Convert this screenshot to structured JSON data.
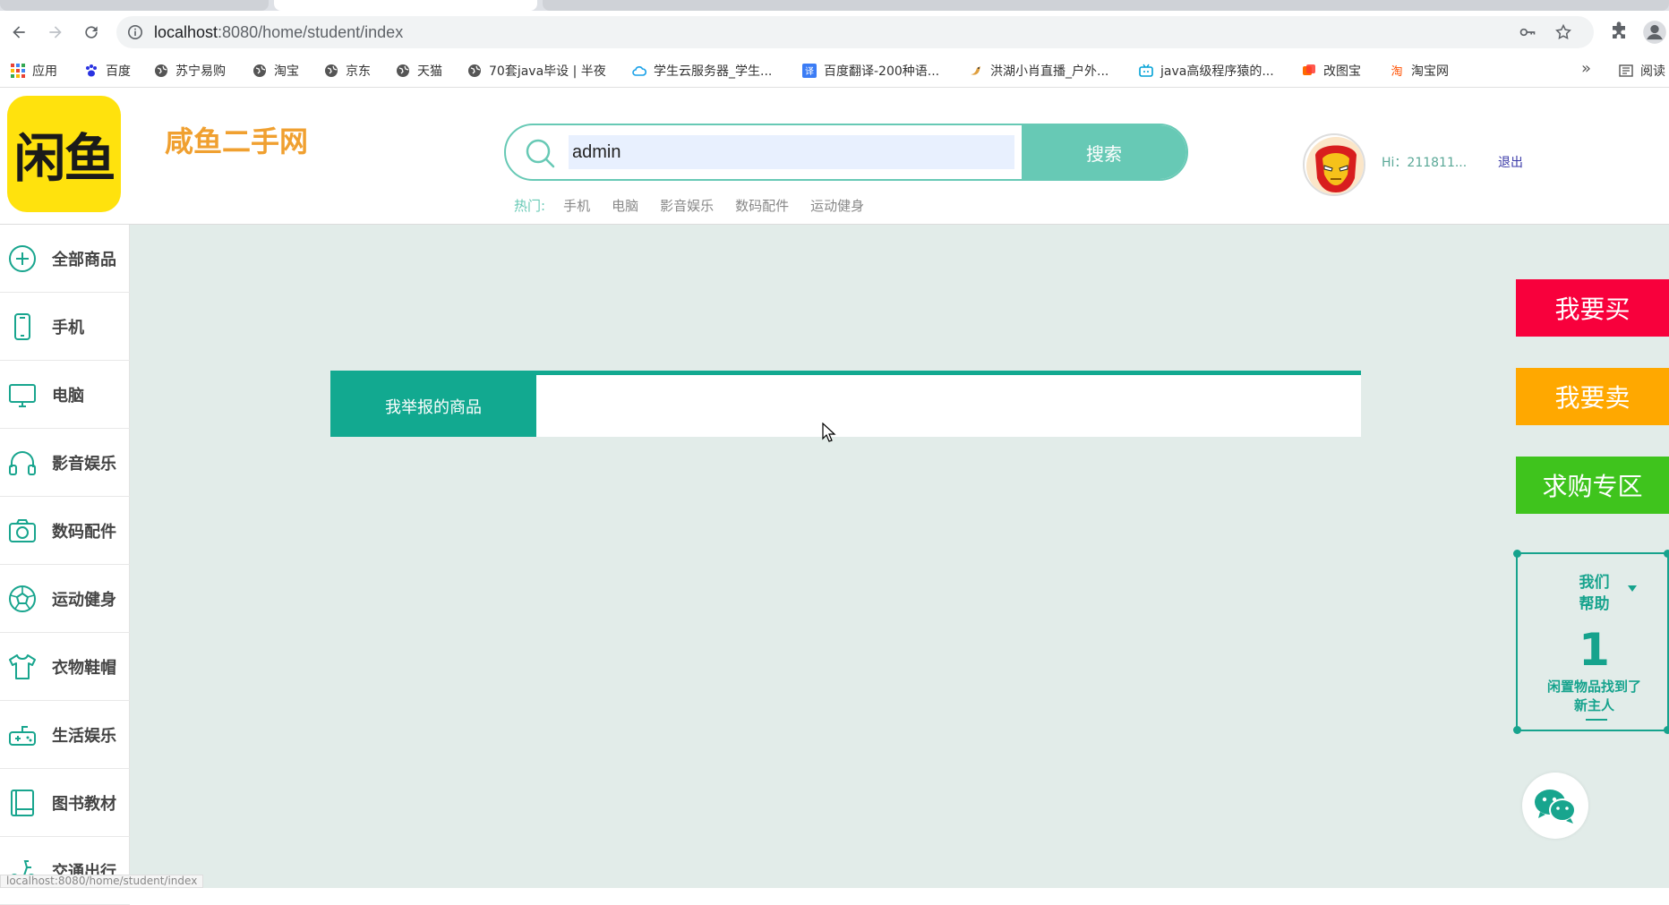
{
  "browser": {
    "url_host": "localhost",
    "url_path": ":8080/home/student/index",
    "bookmarks": [
      {
        "label": "应用",
        "icon": "apps-grid-icon"
      },
      {
        "label": "百度",
        "icon": "baidu-paw-icon"
      },
      {
        "label": "苏宁易购",
        "icon": "globe-icon"
      },
      {
        "label": "淘宝",
        "icon": "globe-icon"
      },
      {
        "label": "京东",
        "icon": "globe-icon"
      },
      {
        "label": "天猫",
        "icon": "globe-icon"
      },
      {
        "label": "70套java毕设 | 半夜",
        "icon": "globe-icon"
      },
      {
        "label": "学生云服务器_学生...",
        "icon": "cloud-icon"
      },
      {
        "label": "百度翻译-200种语...",
        "icon": "translate-icon"
      },
      {
        "label": "洪湖小肖直播_户外...",
        "icon": "bird-icon"
      },
      {
        "label": "java高级程序猿的...",
        "icon": "bilibili-icon"
      },
      {
        "label": "改图宝",
        "icon": "image-edit-icon"
      },
      {
        "label": "淘宝网",
        "icon": "taobao-icon"
      }
    ],
    "more_label": "»",
    "reading_list_label": "阅读",
    "status_url": "localhost:8080/home/student/index"
  },
  "header": {
    "logo_text": "闲鱼",
    "site_name": "咸鱼二手网",
    "search_value": "admin",
    "search_button": "搜索",
    "hot_label": "热门:",
    "hot_items": [
      "手机",
      "电脑",
      "影音娱乐",
      "数码配件",
      "运动健身"
    ],
    "greeting": "Hi：211811...",
    "logout": "退出"
  },
  "sidebar": {
    "items": [
      {
        "label": "全部商品",
        "icon": "plus-circle-icon"
      },
      {
        "label": "手机",
        "icon": "phone-icon"
      },
      {
        "label": "电脑",
        "icon": "monitor-icon"
      },
      {
        "label": "影音娱乐",
        "icon": "headphones-icon"
      },
      {
        "label": "数码配件",
        "icon": "camera-icon"
      },
      {
        "label": "运动健身",
        "icon": "soccer-ball-icon"
      },
      {
        "label": "衣物鞋帽",
        "icon": "tshirt-icon"
      },
      {
        "label": "生活娱乐",
        "icon": "gamepad-icon"
      },
      {
        "label": "图书教材",
        "icon": "book-icon"
      },
      {
        "label": "交通出行",
        "icon": "scooter-icon"
      }
    ]
  },
  "main": {
    "report_tab": "我举报的商品"
  },
  "floating": {
    "buy": "我要买",
    "sell": "我要卖",
    "wanted": "求购专区",
    "help_title_1": "我们",
    "help_title_2": "帮助",
    "help_count": "1",
    "help_desc_1": "闲置物品找到了",
    "help_desc_2": "新主人"
  },
  "colors": {
    "accent": "#67c9b5",
    "accent_dark": "#12a990",
    "buy": "#f8003c",
    "sell": "#ffa800",
    "wanted": "#3fc41d",
    "logo_bg": "#ffe20d",
    "site_name": "#f0a030"
  }
}
